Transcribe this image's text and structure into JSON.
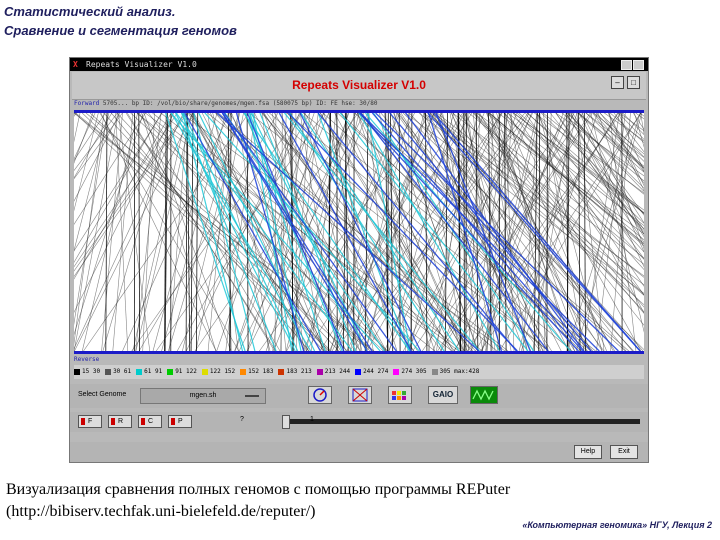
{
  "slide": {
    "title_line1": "Статистический анализ.",
    "title_line2": "Сравнение и сегментация геномов",
    "caption_line1": "Визуализация сравнения полных геномов с помощью программы REPuter",
    "caption_line2": "(http://bibiserv.techfak.uni-bielefeld.de/reputer/)",
    "footer": "«Компьютерная геномика» НГУ, Лекция 2"
  },
  "window": {
    "title": "Repeats Visualizer V1.0",
    "app_name": "Repeats Visualizer V1.0",
    "close_glyph": "X"
  },
  "sequences": {
    "forward_label": "Forward",
    "forward_info": "5705... bp  ID: /vol/bio/share/genomes/mgen.fsa  (580075 bp)  ID: FE hse: 30/80",
    "reverse_label": "Reverse"
  },
  "legend": [
    {
      "label": "15 30",
      "color": "#000000"
    },
    {
      "label": "30 61",
      "color": "#555555"
    },
    {
      "label": "61 91",
      "color": "#00cccc"
    },
    {
      "label": "91 122",
      "color": "#00cc00"
    },
    {
      "label": "122 152",
      "color": "#dddd00"
    },
    {
      "label": "152 183",
      "color": "#ff8800"
    },
    {
      "label": "183 213",
      "color": "#cc3300"
    },
    {
      "label": "213 244",
      "color": "#aa00aa"
    },
    {
      "label": "244 274",
      "color": "#0000ff"
    },
    {
      "label": "274 305",
      "color": "#ff00ff"
    },
    {
      "label": "305 max:428",
      "color": "#888888"
    }
  ],
  "controls": {
    "select_genome_label": "Select Genome",
    "genome_value": "mgen.sh",
    "gaio_label": "GAIO"
  },
  "sliders": {
    "f_label": "F",
    "r_label": "R",
    "c_label": "C",
    "p_label": "P",
    "question_mark": "?",
    "value": "1"
  },
  "buttons": {
    "help": "Help",
    "exit": "Exit"
  },
  "colors": {
    "axis_blue": "#1b1bc8",
    "plot_lines": "#222222",
    "accent_cyan": "#1ec8d8",
    "accent_blue": "#1b3fd8"
  }
}
